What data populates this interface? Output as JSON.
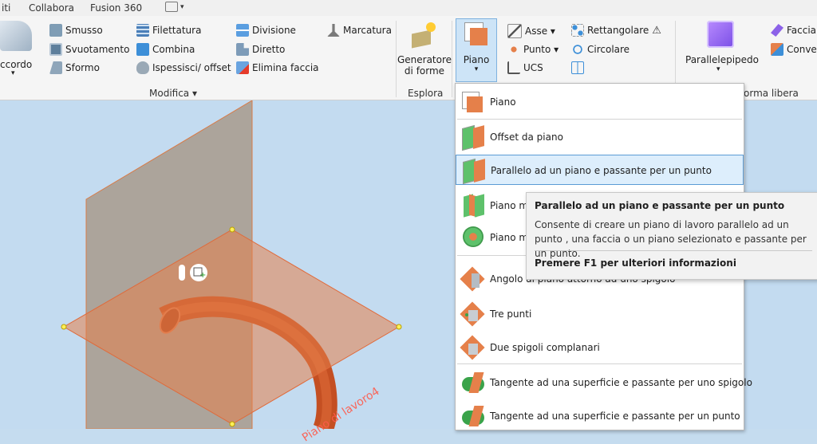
{
  "tabs": {
    "items": [
      "iti",
      "Collabora",
      "Fusion 360"
    ]
  },
  "ribbon": {
    "raccordo_label": "ccordo",
    "modifica": {
      "smusso": "Smusso",
      "svuotamento": "Svuotamento",
      "sformo": "Sformo",
      "filettatura": "Filettatura",
      "combina": "Combina",
      "ispessisci": "Ispessisci/ offset",
      "divisione": "Divisione",
      "diretto": "Diretto",
      "elimina_faccia": "Elimina faccia",
      "marcatura": "Marcatura",
      "group_label": "Modifica ▾"
    },
    "esplora": {
      "generatore_line1": "Generatore",
      "generatore_line2": "di forme",
      "group_label": "Esplora"
    },
    "lavoro": {
      "piano": "Piano",
      "asse": "Asse ▾",
      "punto": "Punto ▾",
      "ucs": "UCS",
      "rettangolare": "Rettangolare",
      "circolare": "Circolare"
    },
    "forma_libera": {
      "parallelepipedo": "Parallelepipedo",
      "faccia": "Faccia",
      "conver": "Conver",
      "group_label": "orma libera"
    }
  },
  "dropdown": {
    "items": [
      "Piano",
      "Offset da piano",
      "Parallelo ad un piano e passante per un punto",
      "Piano m",
      "Piano m",
      "Angolo al piano attorno ad uno spigolo",
      "Tre punti",
      "Due spigoli complanari",
      "Tangente ad una superficie e passante per uno spigolo",
      "Tangente ad una superficie e passante per un punto"
    ]
  },
  "tooltip": {
    "title": "Parallelo ad un piano e passante per un punto",
    "description": "Consente di creare un piano di lavoro parallelo ad un punto , una faccia o un piano selezionato e passante per un punto.",
    "help": "Premere F1 per ulteriori informazioni"
  },
  "viewport": {
    "plane_label": "Piano di lavoro4"
  },
  "colors": {
    "accent": "#e5804a",
    "highlight": "#ddeefc",
    "viewport": "#c3dbf0"
  }
}
